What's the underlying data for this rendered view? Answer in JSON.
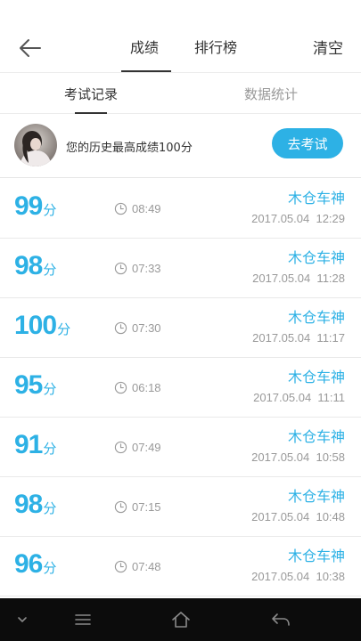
{
  "header": {
    "tabs": [
      {
        "label": "成绩",
        "active": true
      },
      {
        "label": "排行榜",
        "active": false
      }
    ],
    "clear_label": "清空",
    "back_icon": "arrow-left-icon"
  },
  "subtabs": [
    {
      "label": "考试记录",
      "active": true
    },
    {
      "label": "数据统计",
      "active": false
    }
  ],
  "best": {
    "text": "您的历史最高成绩100分",
    "button_label": "去考试"
  },
  "records": [
    {
      "score": "99",
      "unit": "分",
      "duration": "08:49",
      "name": "木仓车神",
      "datetime": "2017.05.04  12:29"
    },
    {
      "score": "98",
      "unit": "分",
      "duration": "07:33",
      "name": "木仓车神",
      "datetime": "2017.05.04  11:28"
    },
    {
      "score": "100",
      "unit": "分",
      "duration": "07:30",
      "name": "木仓车神",
      "datetime": "2017.05.04  11:17"
    },
    {
      "score": "95",
      "unit": "分",
      "duration": "06:18",
      "name": "木仓车神",
      "datetime": "2017.05.04  11:11"
    },
    {
      "score": "91",
      "unit": "分",
      "duration": "07:49",
      "name": "木仓车神",
      "datetime": "2017.05.04  10:58"
    },
    {
      "score": "98",
      "unit": "分",
      "duration": "07:15",
      "name": "木仓车神",
      "datetime": "2017.05.04  10:48"
    },
    {
      "score": "96",
      "unit": "分",
      "duration": "07:48",
      "name": "木仓车神",
      "datetime": "2017.05.04  10:38"
    }
  ],
  "colors": {
    "accent": "#2db1e5",
    "text": "#333333",
    "muted": "#999999",
    "navbar": "#0c0c0c"
  },
  "navbar": {
    "icons": [
      "chevron-down-icon",
      "menu-icon",
      "home-icon",
      "back-icon"
    ]
  }
}
